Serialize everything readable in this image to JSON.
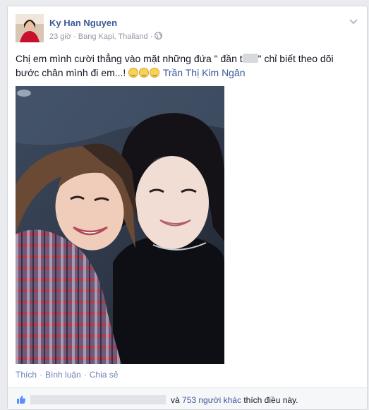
{
  "post": {
    "author": "Ky Han Nguyen",
    "time": "23 giờ",
    "location": "Bang Kapi, Thailand",
    "text_part1": "Chị em mình cười thẳng vào mặt những đứa \" đần t",
    "text_part2": "\" chỉ biết theo dõi",
    "text_part3": "bước chân mình đi em...!",
    "tagged_name": "Trần Thị Kim Ngân",
    "emoji_count": 3
  },
  "actions": {
    "like": "Thích",
    "comment": "Bình luận",
    "share": "Chia sẻ",
    "separator": "·"
  },
  "likes": {
    "connector": "và",
    "others": "753 người khác",
    "suffix": "thích điều này."
  },
  "colors": {
    "link": "#3b5998",
    "meta": "#9197a3",
    "background": "#e9ebee"
  },
  "icons": {
    "privacy": "globe-icon",
    "menu": "chevron-down-icon",
    "like": "thumbs-up-icon"
  }
}
